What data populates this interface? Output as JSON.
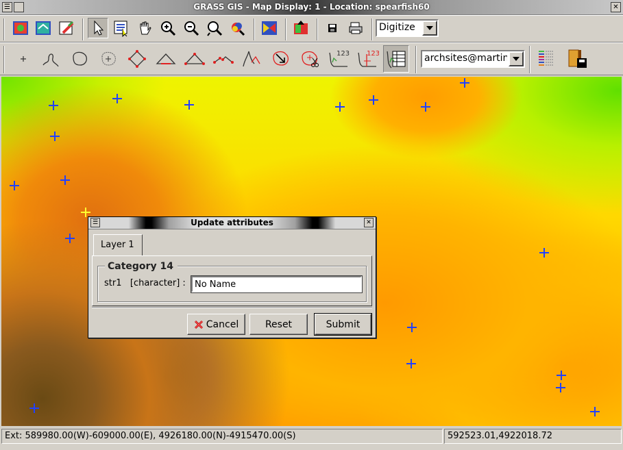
{
  "window": {
    "title": "GRASS GIS - Map Display: 1 - Location: spearfish60",
    "system_menu": "☰",
    "close": "✕"
  },
  "toolbar": {
    "mode_value": "Digitize",
    "tools": [
      "display-map",
      "re-render",
      "erase",
      "pointer",
      "query",
      "pan",
      "zoom-in",
      "zoom-out",
      "zoom-back",
      "zoom-menu",
      "analyze",
      "overlay",
      "save",
      "print"
    ]
  },
  "digit_toolbar": {
    "layer_value": "archsites@martin",
    "label_123": "123"
  },
  "dialog": {
    "title": "Update attributes",
    "tab": "Layer 1",
    "group_label": "Category 14",
    "field_label": "str1   [character] :",
    "field_value": "No Name",
    "buttons": {
      "cancel": "Cancel",
      "reset": "Reset",
      "submit": "Submit"
    }
  },
  "status": {
    "extent": "Ext: 589980.00(W)-609000.00(E), 4926180.00(N)-4915470.00(S)",
    "coords": "592523.01,4922018.72"
  },
  "colors": {
    "site_marker": "#2040ff",
    "selected_marker": "#ffff30"
  }
}
